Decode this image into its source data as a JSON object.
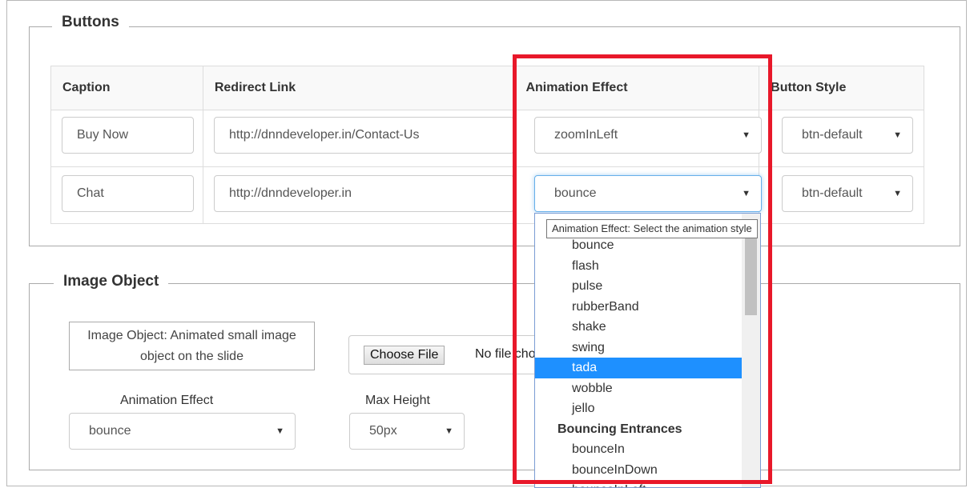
{
  "buttons_section": {
    "legend": "Buttons",
    "headers": {
      "caption": "Caption",
      "redirect_link": "Redirect Link",
      "animation_effect": "Animation Effect",
      "button_style": "Button Style"
    },
    "rows": [
      {
        "caption": "Buy Now",
        "link": "http://dnndeveloper.in/Contact-Us",
        "animation": "zoomInLeft",
        "style": "btn-default"
      },
      {
        "caption": "Chat",
        "link": "http://dnndeveloper.in",
        "animation": "bounce",
        "style": "btn-default"
      }
    ]
  },
  "animation_dropdown": {
    "tooltip": "Animation Effect: Select the animation style",
    "options": [
      "bounce",
      "flash",
      "pulse",
      "rubberBand",
      "shake",
      "swing",
      "tada",
      "wobble",
      "jello"
    ],
    "selected": "tada",
    "group_label": "Bouncing Entrances",
    "group_options": [
      "bounceIn",
      "bounceInDown",
      "bounceInLeft"
    ]
  },
  "image_section": {
    "legend": "Image Object",
    "description": "Image Object: Animated small image object on the slide",
    "file_button": "Choose File",
    "file_status": "No file chosen",
    "animation_label": "Animation Effect",
    "animation_value": "bounce",
    "max_height_label": "Max Height",
    "max_height_value": "50px"
  },
  "colors": {
    "highlight": "#e8182a",
    "selected_option": "#1e90ff",
    "focus_border": "#66afe9"
  },
  "icons": {
    "select_caret": "caret-down-icon"
  }
}
